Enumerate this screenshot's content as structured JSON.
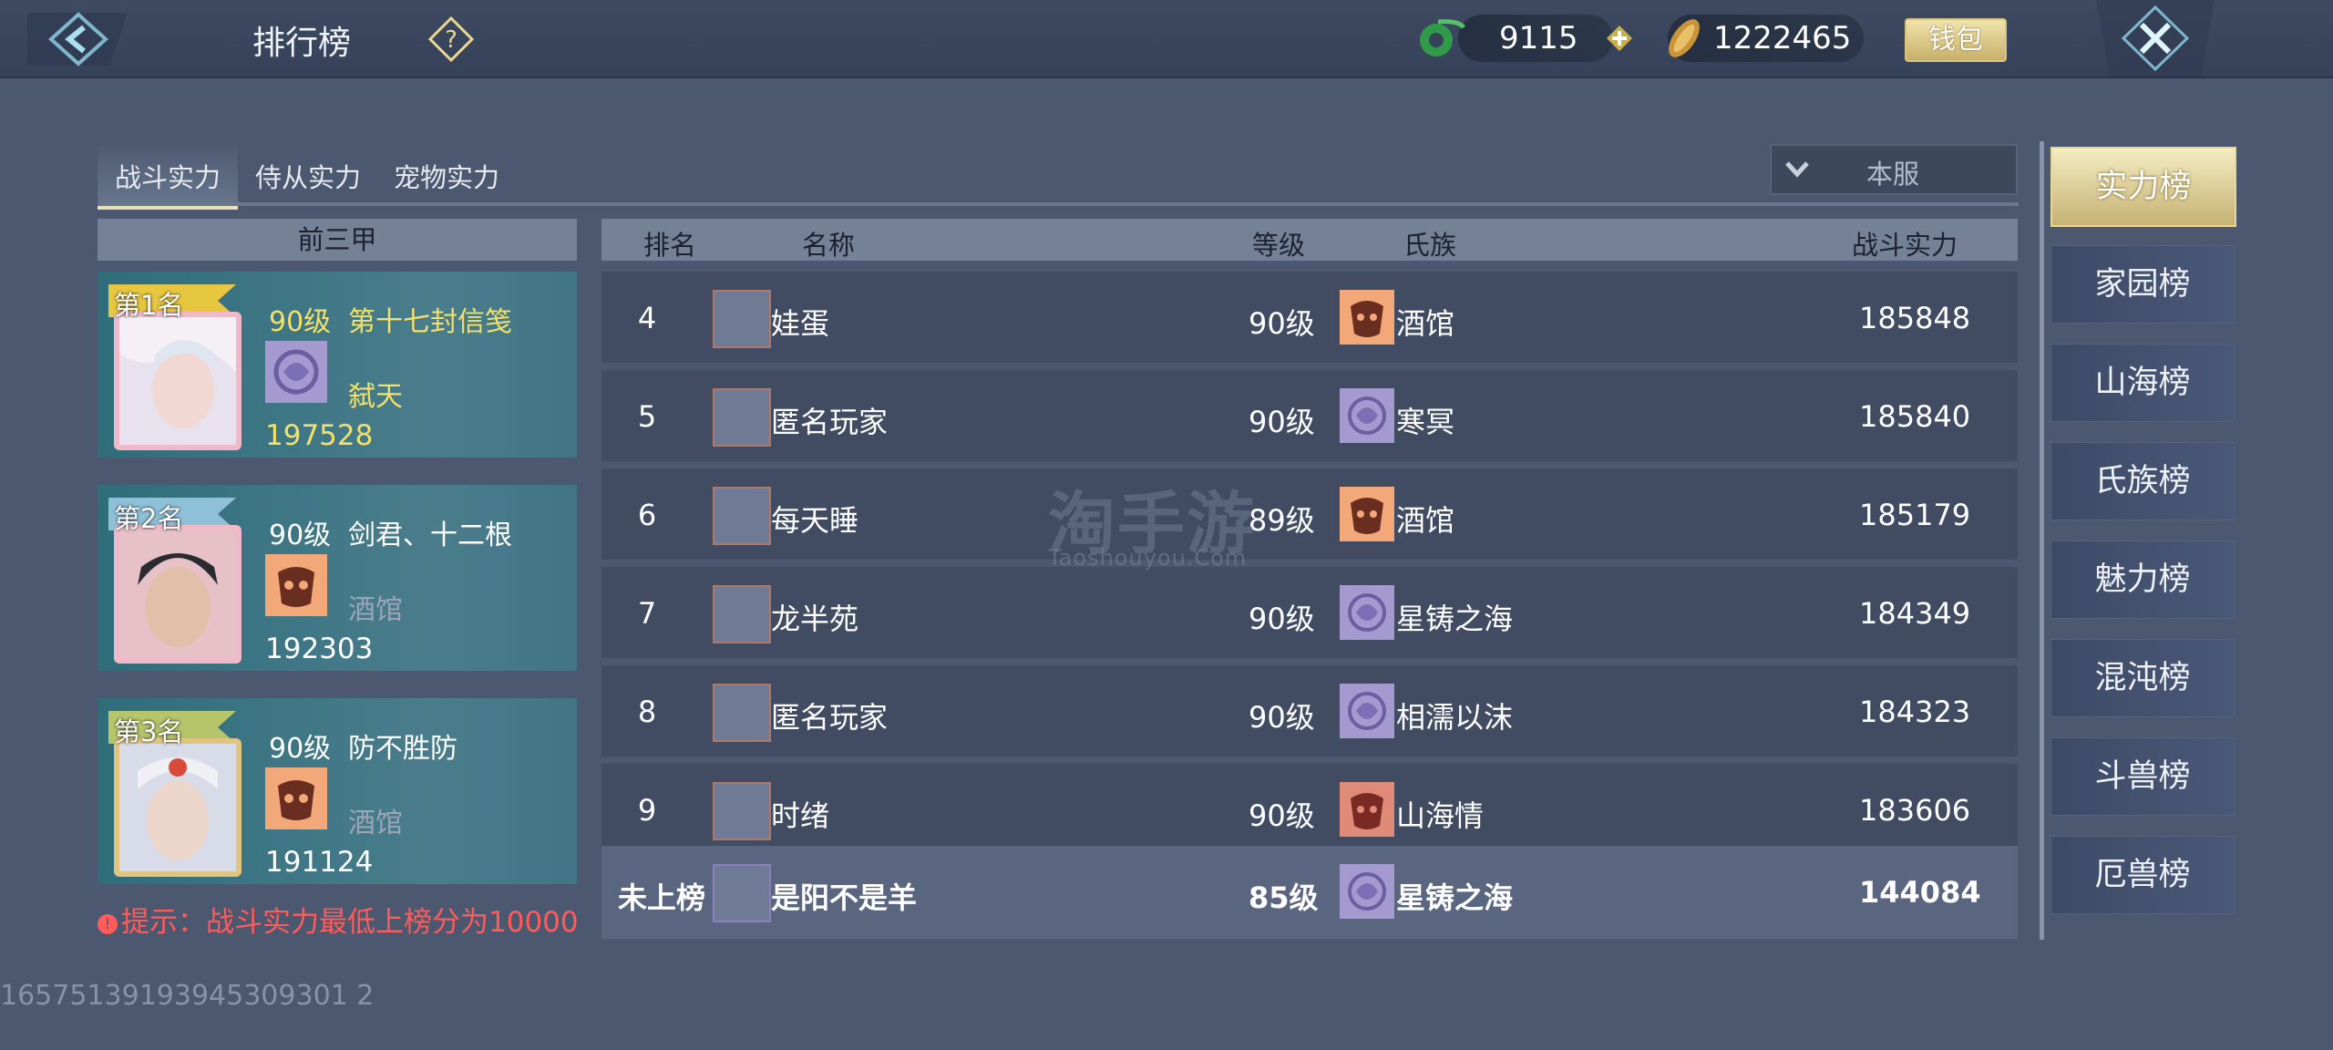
{
  "header": {
    "title": "排行榜",
    "currency_jade": "9115",
    "currency_gold": "1222465",
    "wallet_label": "钱包"
  },
  "tabs": [
    {
      "label": "战斗实力",
      "active": true
    },
    {
      "label": "侍从实力",
      "active": false
    },
    {
      "label": "宠物实力",
      "active": false
    }
  ],
  "server_filter": {
    "selected": "本服"
  },
  "top3": {
    "header": "前三甲",
    "entries": [
      {
        "rank_label": "第1名",
        "level": "90级",
        "name": "第十七封信笺",
        "clan": "弑天",
        "power": "197528",
        "emblem": "purple-swirl"
      },
      {
        "rank_label": "第2名",
        "level": "90级",
        "name": "剑君、十二根",
        "clan": "酒馆",
        "power": "192303",
        "emblem": "orange-mask"
      },
      {
        "rank_label": "第3名",
        "level": "90级",
        "name": "防不胜防",
        "clan": "酒馆",
        "power": "191124",
        "emblem": "orange-mask"
      }
    ],
    "tip": "提示：战斗实力最低上榜分为10000"
  },
  "list": {
    "headers": {
      "rank": "排名",
      "name": "名称",
      "level": "等级",
      "clan": "氏族",
      "power": "战斗实力"
    },
    "rows": [
      {
        "rank": "4",
        "name": "娃蛋",
        "level": "90级",
        "clan": "酒馆",
        "power": "185848",
        "emblem": "orange-mask"
      },
      {
        "rank": "5",
        "name": "匿名玩家",
        "level": "90级",
        "clan": "寒冥",
        "power": "185840",
        "emblem": "purple-swirl"
      },
      {
        "rank": "6",
        "name": "每天睡",
        "level": "89级",
        "clan": "酒馆",
        "power": "185179",
        "emblem": "orange-mask"
      },
      {
        "rank": "7",
        "name": "龙半苑",
        "level": "90级",
        "clan": "星铸之海",
        "power": "184349",
        "emblem": "purple-swirl"
      },
      {
        "rank": "8",
        "name": "匿名玩家",
        "level": "90级",
        "clan": "相濡以沫",
        "power": "184323",
        "emblem": "purple-swirl"
      },
      {
        "rank": "9",
        "name": "时绪",
        "level": "90级",
        "clan": "山海情",
        "power": "183606",
        "emblem": "red-mask"
      }
    ],
    "self_row": {
      "rank": "未上榜",
      "name": "是阳不是羊",
      "level": "85级",
      "clan": "星铸之海",
      "power": "144084",
      "emblem": "purple-swirl"
    }
  },
  "boards": [
    {
      "label": "实力榜",
      "active": true
    },
    {
      "label": "家园榜"
    },
    {
      "label": "山海榜"
    },
    {
      "label": "氏族榜"
    },
    {
      "label": "魅力榜"
    },
    {
      "label": "混沌榜"
    },
    {
      "label": "斗兽榜"
    },
    {
      "label": "厄兽榜"
    }
  ],
  "footer_id": "16575139193945309301 2",
  "watermark": {
    "main": "淘手游",
    "sub": "Taoshouyou.Com"
  },
  "colors": {
    "accent_gold": "#f2e068",
    "tip_red": "#ff5b5b",
    "active_board": "#d9c98a"
  }
}
